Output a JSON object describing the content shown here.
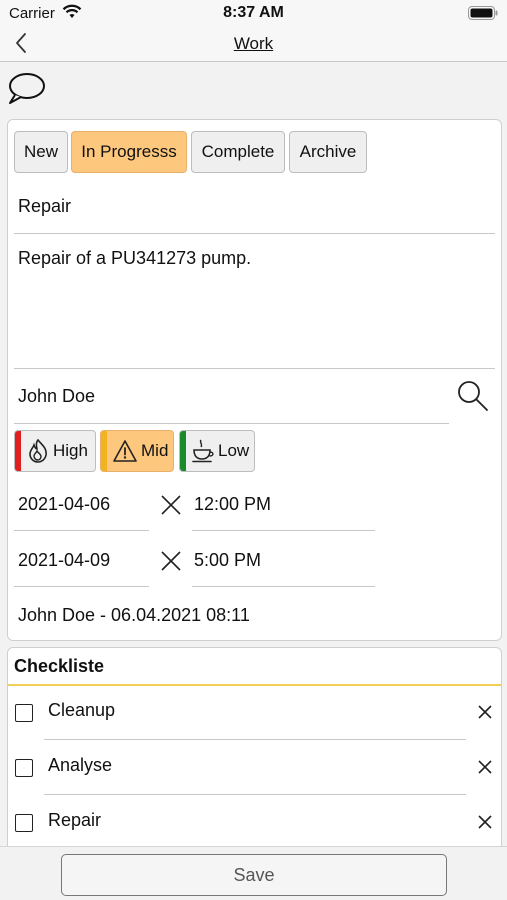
{
  "status_bar": {
    "carrier": "Carrier",
    "time": "8:37 AM"
  },
  "nav": {
    "title": "Work"
  },
  "status_buttons": [
    {
      "label": "New",
      "active": false
    },
    {
      "label": "In Progresss",
      "active": true
    },
    {
      "label": "Complete",
      "active": false
    },
    {
      "label": "Archive",
      "active": false
    }
  ],
  "form": {
    "title": "Repair",
    "description": "Repair of a PU341273 pump.",
    "assignee": "John Doe",
    "start_date": "2021-04-06",
    "start_time": "12:00 PM",
    "end_date": "2021-04-09",
    "end_time": "5:00 PM",
    "created_info": "John Doe - 06.04.2021 08:11"
  },
  "priority": [
    {
      "label": "High",
      "icon": "fire-icon",
      "color": "#e02020",
      "active": false
    },
    {
      "label": "Mid",
      "icon": "warning-icon",
      "color": "#f2b320",
      "active": true
    },
    {
      "label": "Low",
      "icon": "coffee-icon",
      "color": "#1a8a2a",
      "active": false
    }
  ],
  "checklist": {
    "header": "Checkliste",
    "items": [
      {
        "label": "Cleanup",
        "checked": false
      },
      {
        "label": "Analyse",
        "checked": false
      },
      {
        "label": "Repair",
        "checked": false
      }
    ]
  },
  "save": {
    "label": "Save"
  },
  "colors": {
    "active_accent": "#fdc77e",
    "checklist_divider": "#f2cf56"
  }
}
